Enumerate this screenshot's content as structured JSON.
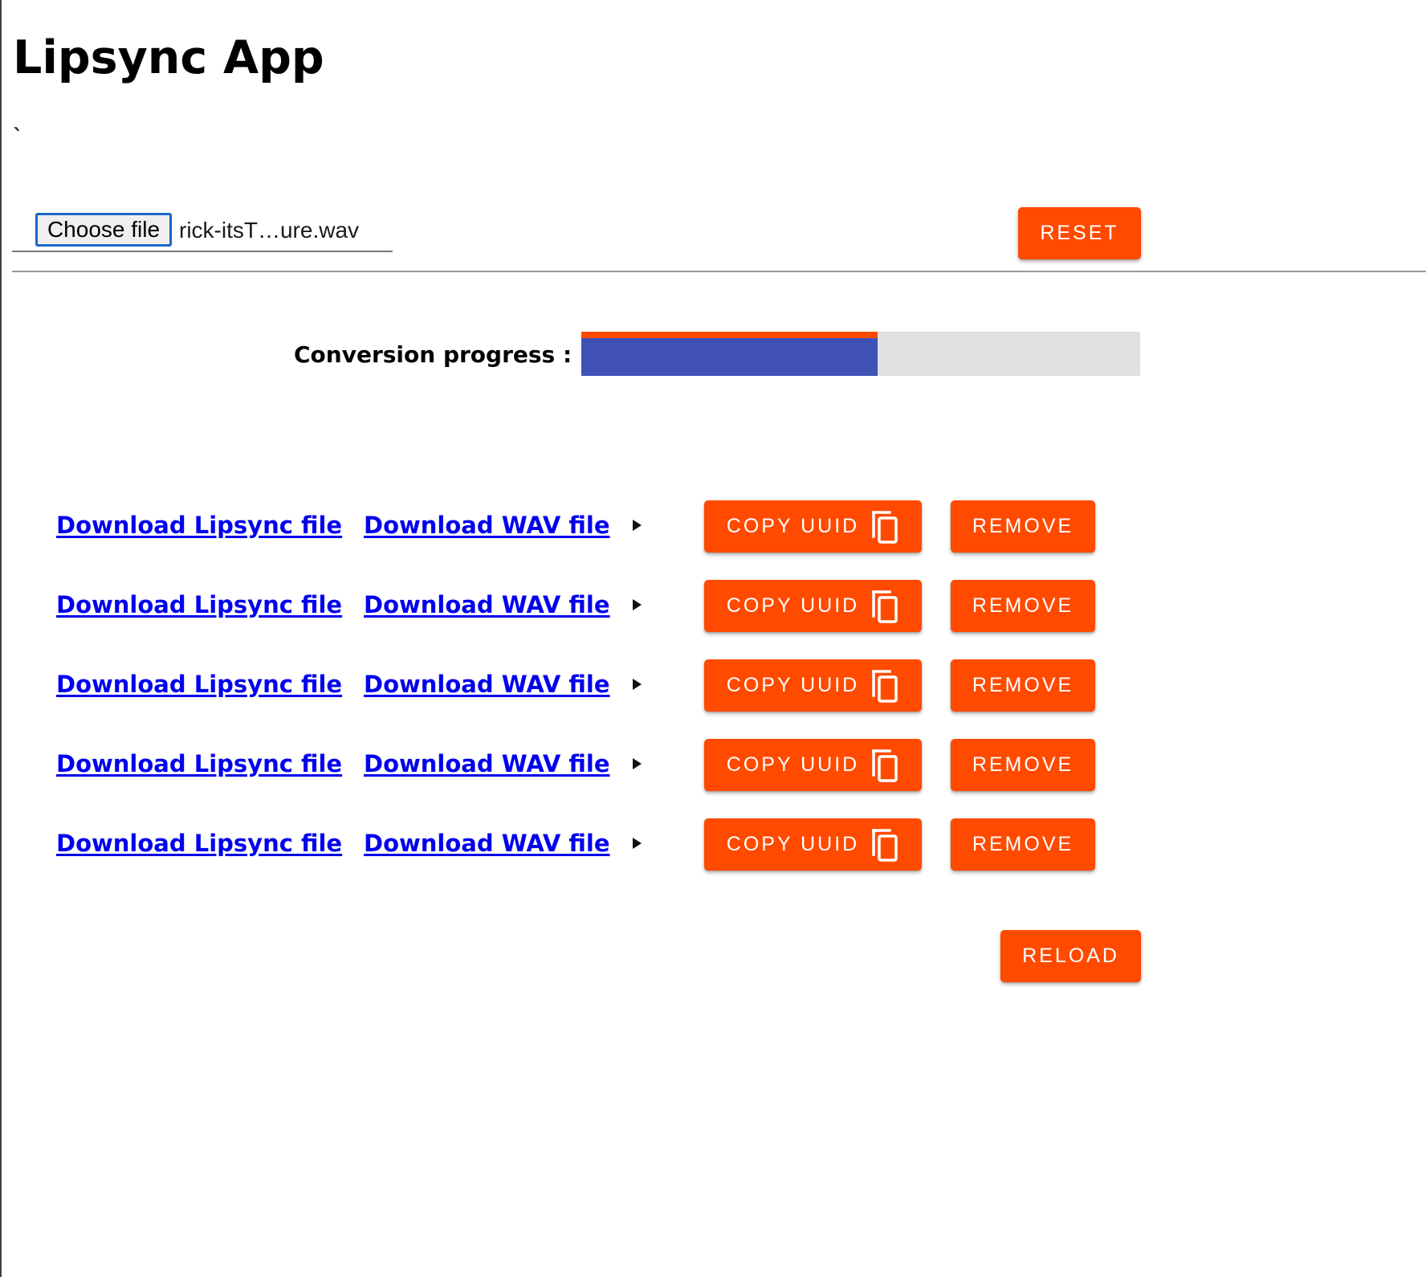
{
  "app": {
    "title": "Lipsync App",
    "stray_char": "`"
  },
  "upload": {
    "choose_label": "Choose file",
    "file_name": "rick-itsT…ure.wav",
    "reset_label": "RESET"
  },
  "progress": {
    "label": "Conversion progress :",
    "value_fraction": 0.53,
    "buffer_fraction": 0.53,
    "bar_color": "#3f51b5",
    "buffer_color": "#ff4a00",
    "track_color": "#e0e0e0"
  },
  "results": {
    "rows": [
      {
        "lipsync_link": "Download Lipsync file",
        "wav_link": "Download WAV file",
        "copy_label": "COPY UUID",
        "remove_label": "REMOVE"
      },
      {
        "lipsync_link": "Download Lipsync file",
        "wav_link": "Download WAV file",
        "copy_label": "COPY UUID",
        "remove_label": "REMOVE"
      },
      {
        "lipsync_link": "Download Lipsync file",
        "wav_link": "Download WAV file",
        "copy_label": "COPY UUID",
        "remove_label": "REMOVE"
      },
      {
        "lipsync_link": "Download Lipsync file",
        "wav_link": "Download WAV file",
        "copy_label": "COPY UUID",
        "remove_label": "REMOVE"
      },
      {
        "lipsync_link": "Download Lipsync file",
        "wav_link": "Download WAV file",
        "copy_label": "COPY UUID",
        "remove_label": "REMOVE"
      }
    ],
    "reload_label": "RELOAD"
  },
  "icons": {
    "expand": "play-triangle-icon",
    "copy": "copy-icon"
  },
  "colors": {
    "accent": "#ff4a00",
    "link": "#0000ee"
  }
}
